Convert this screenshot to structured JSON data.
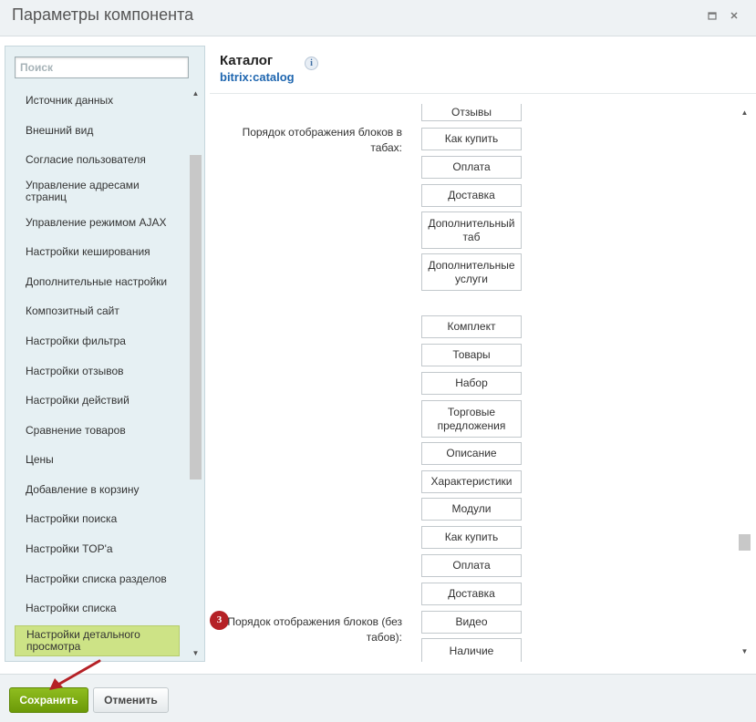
{
  "window": {
    "title": "Параметры компонента",
    "icons": [
      "restore-icon",
      "close-icon"
    ]
  },
  "sidebar": {
    "search_placeholder": "Поиск",
    "items": [
      {
        "label": "Источник данных"
      },
      {
        "label": "Внешний вид"
      },
      {
        "label": "Согласие пользователя"
      },
      {
        "label": "Управление адресами страниц"
      },
      {
        "label": "Управление режимом AJAX"
      },
      {
        "label": "Настройки кеширования"
      },
      {
        "label": "Дополнительные настройки"
      },
      {
        "label": "Композитный сайт"
      },
      {
        "label": "Настройки фильтра"
      },
      {
        "label": "Настройки отзывов"
      },
      {
        "label": "Настройки действий"
      },
      {
        "label": "Сравнение товаров"
      },
      {
        "label": "Цены"
      },
      {
        "label": "Добавление в корзину"
      },
      {
        "label": "Настройки поиска"
      },
      {
        "label": "Настройки TOP'а"
      },
      {
        "label": "Настройки списка разделов"
      },
      {
        "label": "Настройки списка"
      },
      {
        "label": "Настройки детального просмотра"
      }
    ],
    "active_index": 18
  },
  "component": {
    "name": "Каталог",
    "code": "bitrix:catalog",
    "info_glyph": "i"
  },
  "params": {
    "tabs_label": "Порядок отображения блоков в табах:",
    "tabs_blocks": [
      "Отзывы",
      "Как купить",
      "Оплата",
      "Доставка",
      "Дополнительный таб",
      "Дополнительные услуги"
    ],
    "notabs_label": "Порядок отображения блоков (без табов):",
    "notabs_badge": "3",
    "notabs_blocks": [
      "Комплект",
      "Товары",
      "Набор",
      "Торговые предложения",
      "Описание",
      "Характеристики",
      "Модули",
      "Как купить",
      "Оплата",
      "Доставка",
      "Видео",
      "Наличие"
    ]
  },
  "footer": {
    "save_label": "Сохранить",
    "cancel_label": "Отменить"
  },
  "colors": {
    "save_button": "#7aa80f",
    "active_nav": "#cde386",
    "badge": "#b52126",
    "arrow": "#b52126",
    "link": "#2067b0"
  }
}
